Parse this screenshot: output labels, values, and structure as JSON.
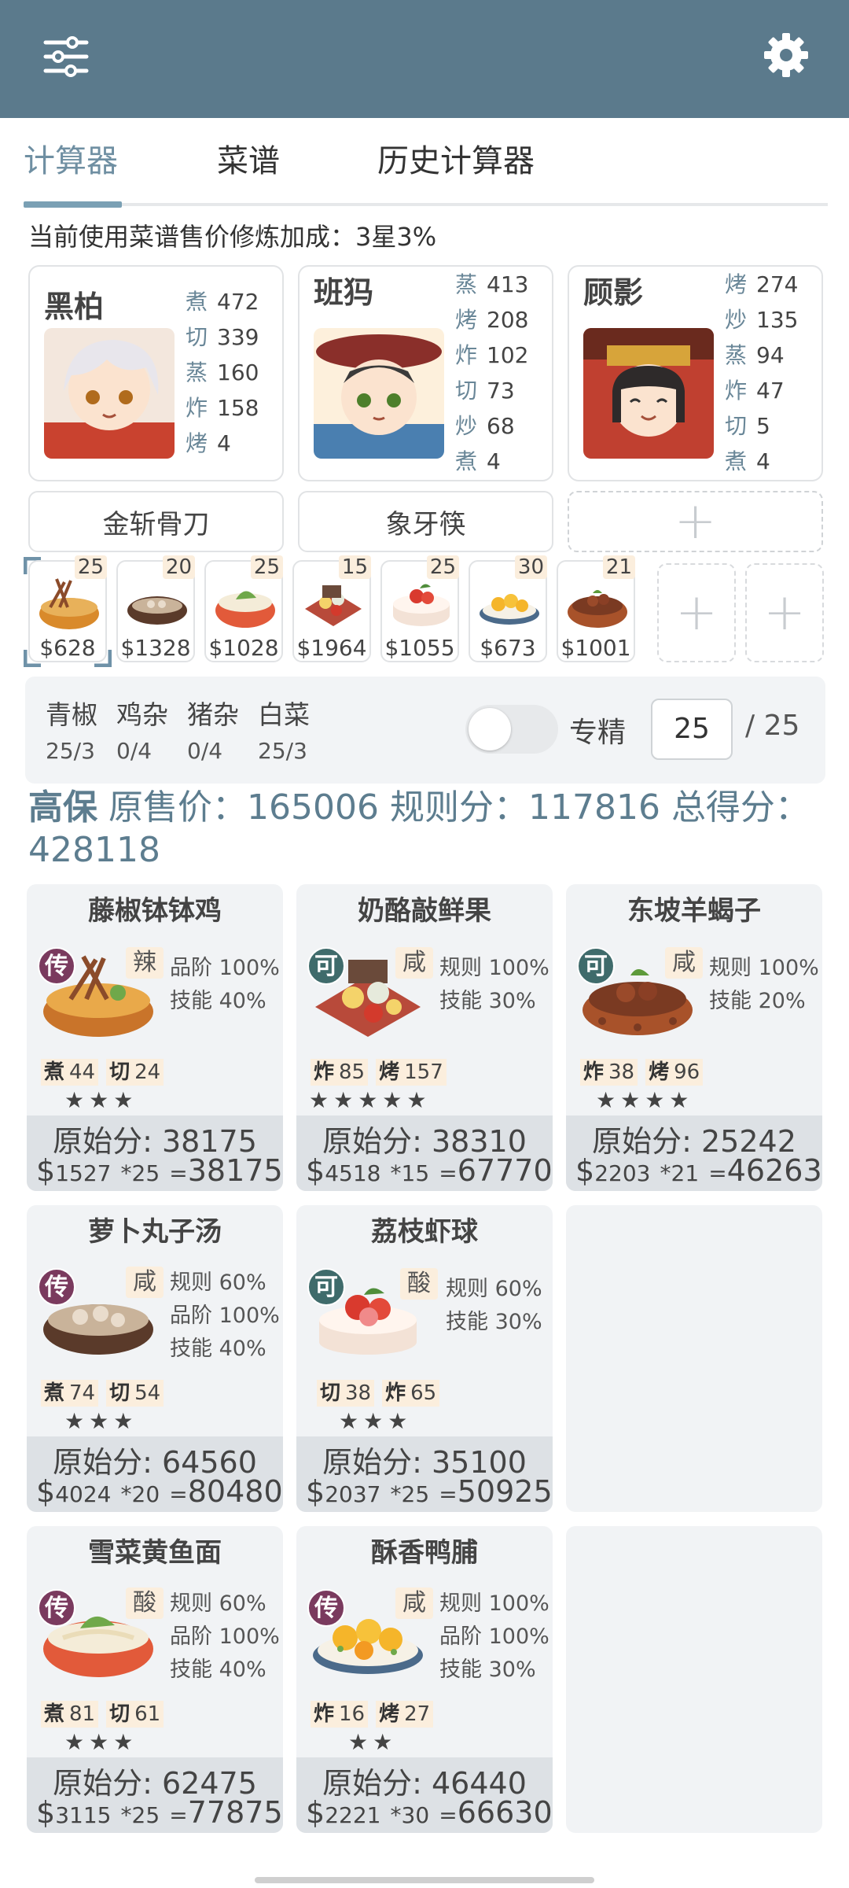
{
  "topbar": {
    "menu_icon": "sliders-icon",
    "settings_icon": "gear-icon",
    "color": "#5b7a8c"
  },
  "tabs": [
    {
      "label": "计算器",
      "active": true
    },
    {
      "label": "菜谱",
      "active": false
    },
    {
      "label": "历史计算器",
      "active": false
    }
  ],
  "bonus_text": "当前使用菜谱售价修炼加成：3星3%",
  "chefs": [
    {
      "name": "黑柏",
      "stats": [
        {
          "k": "煮",
          "v": "472"
        },
        {
          "k": "切",
          "v": "339"
        },
        {
          "k": "蒸",
          "v": "160"
        },
        {
          "k": "炸",
          "v": "158"
        },
        {
          "k": "烤",
          "v": "4"
        }
      ]
    },
    {
      "name": "班犸",
      "stats": [
        {
          "k": "蒸",
          "v": "413"
        },
        {
          "k": "烤",
          "v": "208"
        },
        {
          "k": "炸",
          "v": "102"
        },
        {
          "k": "切",
          "v": "73"
        },
        {
          "k": "炒",
          "v": "68"
        },
        {
          "k": "煮",
          "v": "4"
        }
      ]
    },
    {
      "name": "顾影",
      "stats": [
        {
          "k": "烤",
          "v": "274"
        },
        {
          "k": "炒",
          "v": "135"
        },
        {
          "k": "蒸",
          "v": "94"
        },
        {
          "k": "炸",
          "v": "47"
        },
        {
          "k": "切",
          "v": "5"
        },
        {
          "k": "煮",
          "v": "4"
        }
      ]
    }
  ],
  "equipment": [
    {
      "label": "金斩骨刀"
    },
    {
      "label": "象牙筷"
    }
  ],
  "dish_thumbs": [
    {
      "price": "$628",
      "qty": "25"
    },
    {
      "price": "$1328",
      "qty": "20"
    },
    {
      "price": "$1028",
      "qty": "25"
    },
    {
      "price": "$1964",
      "qty": "15"
    },
    {
      "price": "$1055",
      "qty": "25"
    },
    {
      "price": "$673",
      "qty": "30"
    },
    {
      "price": "$1001",
      "qty": "21"
    }
  ],
  "ingredients": [
    {
      "name": "青椒",
      "count": "25/3"
    },
    {
      "name": "鸡杂",
      "count": "0/4"
    },
    {
      "name": "猪杂",
      "count": "0/4"
    },
    {
      "name": "白菜",
      "count": "25/3"
    }
  ],
  "specialize": {
    "label": "专精",
    "value": "25",
    "max": "/ 25",
    "on": false
  },
  "summary": {
    "level": "高保",
    "orig_label": "原售价：",
    "orig_value": "165006",
    "rule_label": "规则分：",
    "rule_value": "117816",
    "total_label": "总得分：",
    "total_value": "428118"
  },
  "recipes": [
    {
      "name": "藤椒钵钵鸡",
      "badge": "传",
      "flavor": "辣",
      "rules": [
        "品阶 100%",
        "技能 40%"
      ],
      "skills": [
        {
          "k": "煮",
          "v": "44"
        },
        {
          "k": "切",
          "v": "24"
        }
      ],
      "stars": "★★★",
      "orig": "原始分: 38175",
      "unit": "1527",
      "mult": "*25",
      "total": "38175"
    },
    {
      "name": "奶酪敲鲜果",
      "badge": "可",
      "flavor": "咸",
      "rules": [
        "规则 100%",
        "技能 30%"
      ],
      "skills": [
        {
          "k": "炸",
          "v": "85"
        },
        {
          "k": "烤",
          "v": "157"
        }
      ],
      "stars": "★★★★★",
      "orig": "原始分: 38310",
      "unit": "4518",
      "mult": "*15",
      "total": "67770"
    },
    {
      "name": "东坡羊蝎子",
      "badge": "可",
      "flavor": "咸",
      "rules": [
        "规则 100%",
        "技能 20%"
      ],
      "skills": [
        {
          "k": "炸",
          "v": "38"
        },
        {
          "k": "烤",
          "v": "96"
        }
      ],
      "stars": "★★★★",
      "orig": "原始分: 25242",
      "unit": "2203",
      "mult": "*21",
      "total": "46263"
    },
    {
      "name": "萝卜丸子汤",
      "badge": "传",
      "flavor": "咸",
      "rules": [
        "规则 60%",
        "品阶 100%",
        "技能 40%"
      ],
      "skills": [
        {
          "k": "煮",
          "v": "74"
        },
        {
          "k": "切",
          "v": "54"
        }
      ],
      "stars": "★★★",
      "orig": "原始分: 64560",
      "unit": "4024",
      "mult": "*20",
      "total": "80480"
    },
    {
      "name": "荔枝虾球",
      "badge": "可",
      "flavor": "酸",
      "rules": [
        "规则 60%",
        "技能 30%"
      ],
      "skills": [
        {
          "k": "切",
          "v": "38"
        },
        {
          "k": "炸",
          "v": "65"
        }
      ],
      "stars": "★★★",
      "orig": "原始分: 35100",
      "unit": "2037",
      "mult": "*25",
      "total": "50925"
    },
    {
      "name": "雪菜黄鱼面",
      "badge": "传",
      "flavor": "酸",
      "rules": [
        "规则 60%",
        "品阶 100%",
        "技能 40%"
      ],
      "skills": [
        {
          "k": "煮",
          "v": "81"
        },
        {
          "k": "切",
          "v": "61"
        }
      ],
      "stars": "★★★",
      "orig": "原始分: 62475",
      "unit": "3115",
      "mult": "*25",
      "total": "77875"
    },
    {
      "name": "酥香鸭脯",
      "badge": "传",
      "flavor": "咸",
      "rules": [
        "规则 100%",
        "品阶 100%",
        "技能 30%"
      ],
      "skills": [
        {
          "k": "炸",
          "v": "16"
        },
        {
          "k": "烤",
          "v": "27"
        }
      ],
      "stars": "★★",
      "orig": "原始分: 46440",
      "unit": "2221",
      "mult": "*30",
      "total": "66630"
    }
  ],
  "colors": {
    "badge_chuan": "#7a3a5e",
    "badge_ke": "#3f6b6b",
    "accent": "#5d7d8f"
  }
}
